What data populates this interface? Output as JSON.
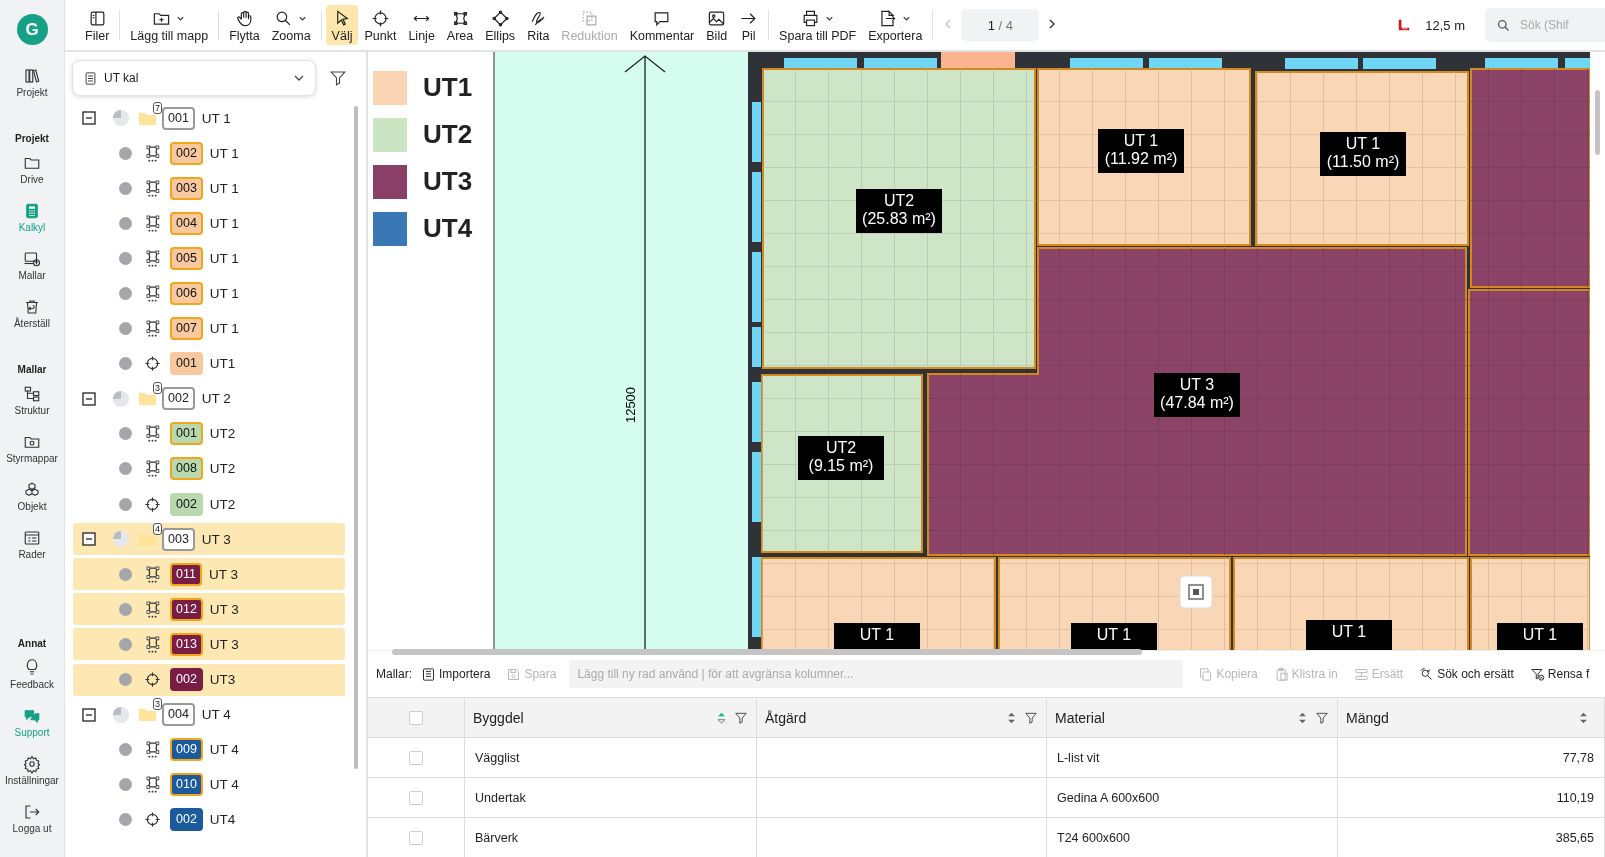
{
  "rail": {
    "logo": "G",
    "items": [
      {
        "kind": "link",
        "label": "Projekt",
        "selected": false
      },
      {
        "kind": "heading",
        "label": "Projekt"
      },
      {
        "kind": "link",
        "label": "Drive",
        "selected": false
      },
      {
        "kind": "link",
        "label": "Kalkyl",
        "selected": true
      },
      {
        "kind": "link",
        "label": "Mallar",
        "selected": false
      },
      {
        "kind": "link",
        "label": "Återställ",
        "selected": false
      },
      {
        "kind": "heading",
        "label": "Mallar"
      },
      {
        "kind": "link",
        "label": "Struktur",
        "selected": false
      },
      {
        "kind": "link",
        "label": "Styrmappar",
        "selected": false
      },
      {
        "kind": "link",
        "label": "Objekt",
        "selected": false
      },
      {
        "kind": "link",
        "label": "Rader",
        "selected": false
      },
      {
        "kind": "heading",
        "label": "Annat"
      },
      {
        "kind": "link",
        "label": "Feedback",
        "selected": false
      },
      {
        "kind": "accent",
        "label": "Support"
      },
      {
        "kind": "link",
        "label": "Inställningar",
        "selected": false
      },
      {
        "kind": "link",
        "label": "Logga ut",
        "selected": false
      }
    ]
  },
  "toolbar": {
    "tools": [
      {
        "label": "Filer",
        "selected": false,
        "disabled": false,
        "menu": false
      },
      {
        "label": "Lägg till mapp",
        "selected": false,
        "disabled": false,
        "menu": true
      },
      {
        "label": "Flytta",
        "selected": false,
        "disabled": false,
        "menu": false
      },
      {
        "label": "Zooma",
        "selected": false,
        "disabled": false,
        "menu": true
      },
      {
        "label": "Välj",
        "selected": true,
        "disabled": false,
        "menu": false
      },
      {
        "label": "Punkt",
        "selected": false,
        "disabled": false,
        "menu": false
      },
      {
        "label": "Linje",
        "selected": false,
        "disabled": false,
        "menu": false
      },
      {
        "label": "Area",
        "selected": false,
        "disabled": false,
        "menu": false
      },
      {
        "label": "Ellips",
        "selected": false,
        "disabled": false,
        "menu": false
      },
      {
        "label": "Rita",
        "selected": false,
        "disabled": false,
        "menu": false
      },
      {
        "label": "Reduktion",
        "selected": false,
        "disabled": true,
        "menu": false
      },
      {
        "label": "Kommentar",
        "selected": false,
        "disabled": false,
        "menu": false
      },
      {
        "label": "Bild",
        "selected": false,
        "disabled": false,
        "menu": false
      },
      {
        "label": "Pil",
        "selected": false,
        "disabled": false,
        "menu": false
      },
      {
        "label": "Spara till PDF",
        "selected": false,
        "disabled": false,
        "menu": true
      },
      {
        "label": "Exportera",
        "selected": false,
        "disabled": false,
        "menu": true
      }
    ],
    "pager": {
      "current": "1",
      "rest": "/ 4",
      "prev_disabled": true,
      "next_disabled": false
    },
    "scale": "12,5 m",
    "search": {
      "placeholder": "Sök (Shif"
    }
  },
  "tree": {
    "dropdown": {
      "value": "UT kal"
    },
    "groups": [
      {
        "code": "001",
        "label": "UT 1",
        "count": "7",
        "expanded": true,
        "selected": false,
        "children": [
          {
            "kind": "area",
            "code": "002",
            "label": "UT 1",
            "color": "#f8c9a0",
            "selected": false
          },
          {
            "kind": "area",
            "code": "003",
            "label": "UT 1",
            "color": "#f8c9a0",
            "selected": false
          },
          {
            "kind": "area",
            "code": "004",
            "label": "UT 1",
            "color": "#f8c9a0",
            "selected": false
          },
          {
            "kind": "area",
            "code": "005",
            "label": "UT 1",
            "color": "#f8c9a0",
            "selected": false
          },
          {
            "kind": "area",
            "code": "006",
            "label": "UT 1",
            "color": "#f8c9a0",
            "selected": false
          },
          {
            "kind": "area",
            "code": "007",
            "label": "UT 1",
            "color": "#f8c9a0",
            "selected": false
          },
          {
            "kind": "point",
            "code": "001",
            "label": "UT1",
            "color": "#f8c9a0",
            "selected": false
          }
        ]
      },
      {
        "code": "002",
        "label": "UT 2",
        "count": "3",
        "expanded": true,
        "selected": false,
        "children": [
          {
            "kind": "area",
            "code": "001",
            "label": "UT2",
            "color": "#b8d9ae",
            "selected": false
          },
          {
            "kind": "area",
            "code": "008",
            "label": "UT2",
            "color": "#b8d9ae",
            "selected": false
          },
          {
            "kind": "point",
            "code": "002",
            "label": "UT2",
            "color": "#b8d9ae",
            "selected": false
          }
        ]
      },
      {
        "code": "003",
        "label": "UT 3",
        "count": "4",
        "expanded": true,
        "selected": true,
        "children": [
          {
            "kind": "area",
            "code": "011",
            "label": "UT 3",
            "color": "#7a1d44",
            "selected": true
          },
          {
            "kind": "area",
            "code": "012",
            "label": "UT 3",
            "color": "#7a1d44",
            "selected": true
          },
          {
            "kind": "area",
            "code": "013",
            "label": "UT 3",
            "color": "#7a1d44",
            "selected": true
          },
          {
            "kind": "point",
            "code": "002",
            "label": "UT3",
            "color": "#7a1d44",
            "selected": true
          }
        ]
      },
      {
        "code": "004",
        "label": "UT 4",
        "count": "3",
        "expanded": true,
        "selected": false,
        "children": [
          {
            "kind": "area",
            "code": "009",
            "label": "UT 4",
            "color": "#1c5a9e",
            "selected": false
          },
          {
            "kind": "area",
            "code": "010",
            "label": "UT 4",
            "color": "#1c5a9e",
            "selected": false
          },
          {
            "kind": "point",
            "code": "002",
            "label": "UT4",
            "color": "#1c5a9e",
            "selected": false
          }
        ]
      }
    ]
  },
  "plan": {
    "legend": [
      {
        "label": "UT1",
        "color": "#f9d5b3"
      },
      {
        "label": "UT2",
        "color": "#cbe4c3"
      },
      {
        "label": "UT3",
        "color": "#8a3f66"
      },
      {
        "label": "UT4",
        "color": "#3a78b5"
      }
    ],
    "dimension": "12500",
    "rooms": [
      {
        "label": "UT2",
        "area": "(25.83 m²)",
        "color": "#cfe5c8"
      },
      {
        "label": "UT 1",
        "area": "(11.92 m²)",
        "color": "#f9d7b6"
      },
      {
        "label": "UT 1",
        "area": "(11.50 m²)",
        "color": "#f9d7b6"
      },
      {
        "color": "#8b4468"
      },
      {
        "label": "UT 3",
        "area": "(47.84 m²)",
        "color": "#8b4468"
      },
      {
        "color": "#8b4468"
      },
      {
        "label": "UT2",
        "area": "(9.15 m²)",
        "color": "#cfe5c8"
      },
      {
        "label": "UT 1",
        "color": "#f9d7b6"
      },
      {
        "label": "UT 1",
        "color": "#f9d7b6"
      },
      {
        "label": "UT 1",
        "color": "#f9d7b6"
      },
      {
        "label": "UT 1",
        "color": "#f9d7b6"
      }
    ]
  },
  "templates_bar": {
    "label": "Mallar:",
    "actions": [
      {
        "label": "Importera",
        "disabled": false
      },
      {
        "label": "Spara",
        "disabled": true
      }
    ],
    "input": {
      "placeholder": "Lägg till ny rad använd | för att avgränsa kolumner..."
    },
    "edit_actions": [
      {
        "label": "Kopiera",
        "disabled": true
      },
      {
        "label": "Klistra in",
        "disabled": true
      },
      {
        "label": "Ersätt",
        "disabled": true
      },
      {
        "label": "Sök och ersätt",
        "disabled": false
      },
      {
        "label": "Rensa f",
        "disabled": false
      }
    ]
  },
  "table": {
    "header_checked": false,
    "columns": [
      {
        "label": "Byggdel",
        "sorted": true,
        "filter": true
      },
      {
        "label": "Åtgärd",
        "sorted": false,
        "filter": true
      },
      {
        "label": "Material",
        "sorted": false,
        "filter": true
      },
      {
        "label": "Mängd",
        "sorted": false,
        "filter": false
      }
    ],
    "rows": [
      {
        "checked": false,
        "byggdel": "Vägglist",
        "material": "L-list vit",
        "mangd": "77,78"
      },
      {
        "checked": false,
        "byggdel": "Undertak",
        "material": "Gedina A 600x600",
        "mangd": "110,19"
      },
      {
        "checked": false,
        "byggdel": "Bärverk",
        "material": "T24 600x600",
        "mangd": "385,65"
      }
    ]
  }
}
